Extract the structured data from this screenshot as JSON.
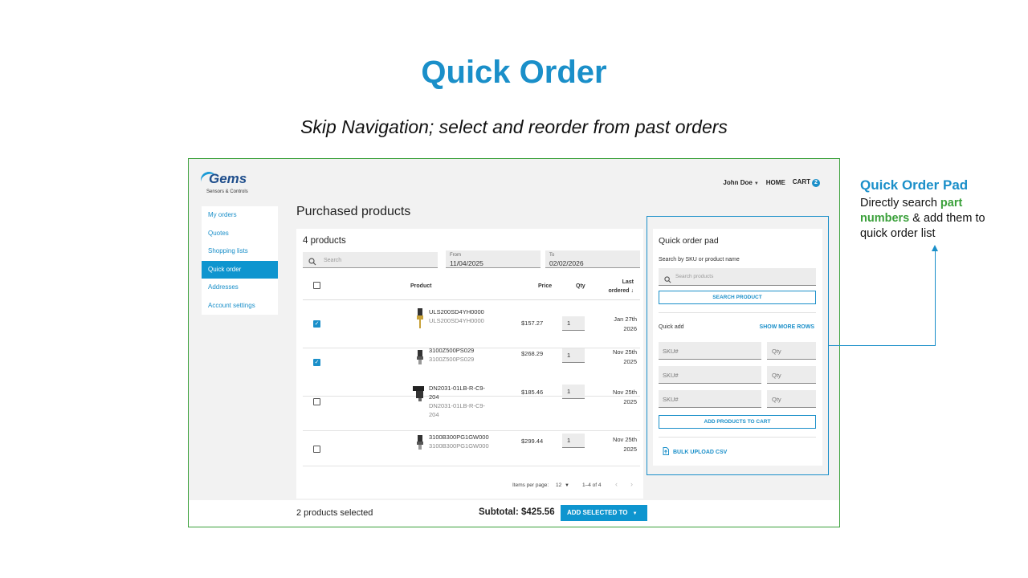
{
  "slide": {
    "title": "Quick Order",
    "subtitle": "Skip Navigation; select and reorder from past orders"
  },
  "header": {
    "logo_text": "Gems",
    "logo_subtext": "Sensors & Controls",
    "user_name": "John Doe",
    "home_label": "HOME",
    "cart_label": "CART",
    "cart_count": "2"
  },
  "sidebar": {
    "items": [
      {
        "label": "My orders"
      },
      {
        "label": "Quotes"
      },
      {
        "label": "Shopping lists"
      },
      {
        "label": "Quick order"
      },
      {
        "label": "Addresses"
      },
      {
        "label": "Account settings"
      }
    ],
    "active_index": 3
  },
  "main": {
    "page_title": "Purchased products",
    "count_label": "4 products",
    "search_placeholder": "Search",
    "from_label": "From",
    "from_value": "11/04/2025",
    "to_label": "To",
    "to_value": "02/02/2026",
    "columns": {
      "product": "Product",
      "price": "Price",
      "qty": "Qty",
      "last_ordered": "Last ordered"
    },
    "rows": [
      {
        "checked": true,
        "sku": "ULS200SD4YH0000",
        "sku_sub": "ULS200SD4YH0000",
        "price": "$157.27",
        "qty": "1",
        "last_ordered": "Jan 27th 2026"
      },
      {
        "checked": true,
        "sku": "3100Z500PS029",
        "sku_sub": "3100Z500PS029",
        "price": "$268.29",
        "qty": "1",
        "last_ordered": "Nov 25th 2025"
      },
      {
        "checked": false,
        "sku": "DN2031-01LB-R-C9-204",
        "sku_sub": "DN2031-01LB-R-C9-204",
        "price": "$185.46",
        "qty": "1",
        "last_ordered": "Nov 25th 2025"
      },
      {
        "checked": false,
        "sku": "3100B300PG1GW000",
        "sku_sub": "3100B300PG1GW000",
        "price": "$299.44",
        "qty": "1",
        "last_ordered": "Nov 25th 2025"
      }
    ],
    "pagination": {
      "items_per_page_label": "Items per page:",
      "items_per_page": "12",
      "range": "1–4 of 4"
    }
  },
  "footer": {
    "selected_count": "2 products selected",
    "subtotal": "Subtotal: $425.56",
    "add_selected": "ADD SELECTED TO"
  },
  "quick_order_pad": {
    "title": "Quick order pad",
    "search_label": "Search by SKU or product name",
    "search_placeholder": "Search products",
    "search_button": "SEARCH PRODUCT",
    "quick_add_label": "Quick add",
    "show_more": "SHOW MORE ROWS",
    "sku_placeholder": "SKU#",
    "qty_placeholder": "Qty",
    "add_to_cart": "ADD PRODUCTS TO CART",
    "bulk_upload": "BULK UPLOAD CSV"
  },
  "annotation": {
    "title": "Quick Order Pad",
    "text_1": "Directly search ",
    "text_hl": "part numbers",
    "text_2": " & add them to quick order list"
  }
}
